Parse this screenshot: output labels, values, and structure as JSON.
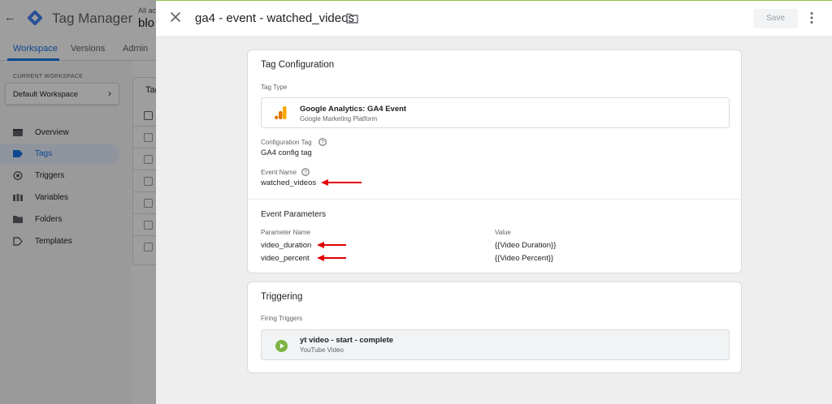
{
  "app": {
    "title": "Tag Manager",
    "account_prefix": "All acc",
    "container_name": "blo"
  },
  "nav": {
    "tabs": [
      {
        "label": "Workspace",
        "active": true
      },
      {
        "label": "Versions",
        "active": false
      },
      {
        "label": "Admin",
        "active": false
      }
    ]
  },
  "sidebar": {
    "current_workspace_label": "CURRENT WORKSPACE",
    "workspace_name": "Default Workspace",
    "items": [
      {
        "label": "Overview",
        "icon": "overview-icon"
      },
      {
        "label": "Tags",
        "icon": "tag-icon",
        "active": true
      },
      {
        "label": "Triggers",
        "icon": "trigger-icon"
      },
      {
        "label": "Variables",
        "icon": "variables-icon"
      },
      {
        "label": "Folders",
        "icon": "folder-icon"
      },
      {
        "label": "Templates",
        "icon": "template-icon"
      }
    ]
  },
  "tags_list": {
    "title": "Tag"
  },
  "panel": {
    "title": "ga4 - event - watched_videos",
    "save_label": "Save"
  },
  "tag_config": {
    "title": "Tag Configuration",
    "tag_type_label": "Tag Type",
    "tag_type_name": "Google Analytics: GA4 Event",
    "tag_type_sub": "Google Marketing Platform",
    "config_tag_label": "Configuration Tag",
    "config_tag_value": "GA4 config tag",
    "event_name_label": "Event Name",
    "event_name_value": "watched_videos",
    "event_params_title": "Event Parameters",
    "param_name_header": "Parameter Name",
    "value_header": "Value",
    "params": [
      {
        "name": "video_duration",
        "value": "{{Video Duration}}"
      },
      {
        "name": "video_percent",
        "value": "{{Video Percent}}"
      }
    ]
  },
  "triggering": {
    "title": "Triggering",
    "firing_label": "Firing Triggers",
    "trigger_name": "yt video - start - complete",
    "trigger_type": "YouTube Video"
  },
  "colors": {
    "accent": "#1a73e8",
    "annotation_arrow": "#e00000",
    "ga_orange": "#f9ab00",
    "ga_dark_orange": "#e37400",
    "youtube_trigger_green": "#7cb342"
  }
}
